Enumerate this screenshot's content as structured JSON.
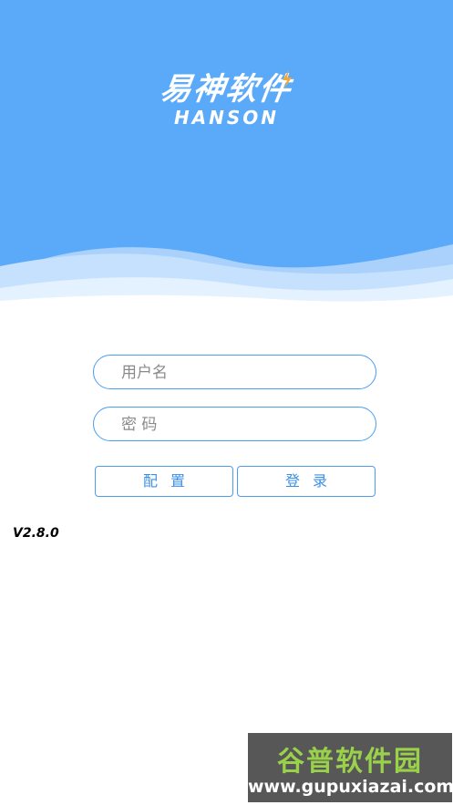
{
  "logo": {
    "name_cn": "易神软件",
    "name_en": "HANSON"
  },
  "login_form": {
    "username_placeholder": "用户名",
    "password_placeholder": "密 码",
    "config_button_label": "配置",
    "login_button_label": "登录"
  },
  "version": "V2.8.0",
  "watermark": {
    "text": "谷普软件园",
    "url": "www.gupuxiazai.com"
  },
  "colors": {
    "header_blue": "#5aaaf9",
    "border_blue": "#4a9eee",
    "button_text_blue": "#3d8fe6",
    "watermark_green": "#9ad14a"
  }
}
